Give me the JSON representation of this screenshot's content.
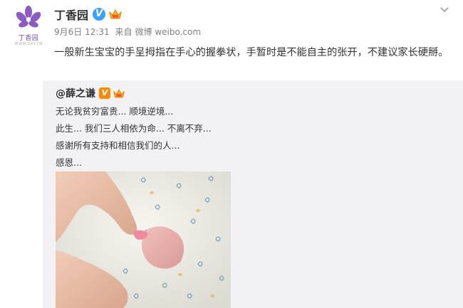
{
  "post": {
    "author": "丁香园",
    "avatar_caption": "丁香园",
    "avatar_subcaption": "WWW.DXY.CN",
    "time": "9月6日 12:31",
    "source_prefix": "来自",
    "source": "微博 weibo.com",
    "text": "一般新生宝宝的手呈拇指在手心的握拳状，手暂时是不能自主的张开，不建议家长硬掰。",
    "verified_letter": "V"
  },
  "repost": {
    "author": "@薛之谦",
    "verified_letter": "V",
    "lines": [
      "无论我贫穷富贵... 顺境逆境...",
      "此生... 我们三人相依为命... 不离不弃...",
      "感谢所有支持和相信我们的人...",
      "感恩..."
    ]
  },
  "colors": {
    "verified_blue": "#3ba1ff",
    "verified_orange": "#ff8a00",
    "repost_bg": "#f2f2f5",
    "brand_purple": "#7a4fa8"
  }
}
